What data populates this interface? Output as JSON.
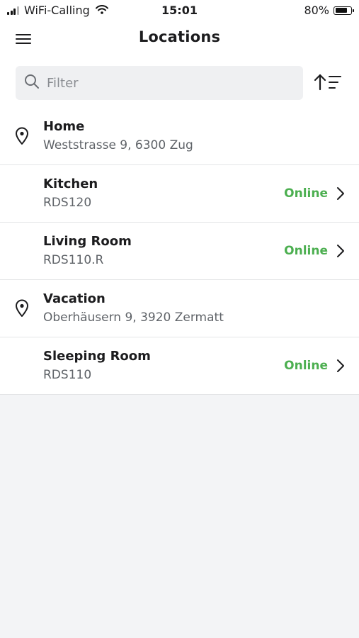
{
  "status_bar": {
    "carrier": "WiFi-Calling",
    "time": "15:01",
    "battery": "80%",
    "battery_level": 0.8
  },
  "header": {
    "title": "Locations",
    "menu_icon": "hamburger-menu-icon",
    "sort_icon": "sort-ascending-icon"
  },
  "filter": {
    "placeholder": "Filter",
    "value": "",
    "icon": "search-icon"
  },
  "colors": {
    "online": "#4caf50",
    "background": "#f3f4f6",
    "filter_background": "#eff0f2"
  },
  "locations": [
    {
      "type": "location",
      "title": "Home",
      "subtitle": "Weststrasse 9, 6300 Zug",
      "icon": "location-pin-icon"
    },
    {
      "type": "room",
      "title": "Kitchen",
      "subtitle": "RDS120",
      "status": "Online",
      "icon": "chevron-right-icon"
    },
    {
      "type": "room",
      "title": "Living Room",
      "subtitle": "RDS110.R",
      "status": "Online",
      "icon": "chevron-right-icon"
    },
    {
      "type": "location",
      "title": "Vacation",
      "subtitle": "Oberhäusern 9, 3920 Zermatt",
      "icon": "location-pin-icon"
    },
    {
      "type": "room",
      "title": "Sleeping Room",
      "subtitle": "RDS110",
      "status": "Online",
      "icon": "chevron-right-icon"
    }
  ]
}
